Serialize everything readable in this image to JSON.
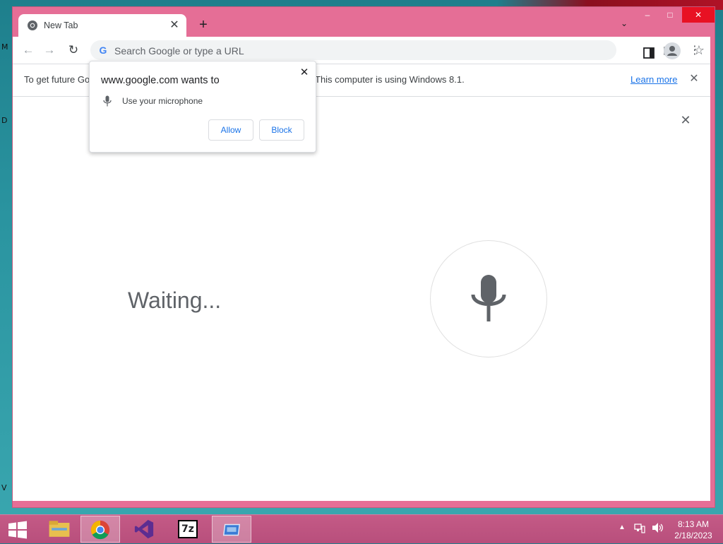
{
  "browser": {
    "tab": {
      "title": "New Tab",
      "favicon": "chrome-icon"
    },
    "window_controls": {
      "minimize": "–",
      "maximize": "□",
      "close": "✕"
    },
    "omnibox": {
      "placeholder": "Search Google or type a URL",
      "value": ""
    },
    "infobar": {
      "text_left": "To get future Go",
      "text_right": "This computer is using Windows 8.1.",
      "learn_more": "Learn more"
    },
    "permission_popup": {
      "title": "www.google.com wants to",
      "item": "Use your microphone",
      "allow": "Allow",
      "block": "Block"
    },
    "voice": {
      "status": "Waiting..."
    }
  },
  "taskbar": {
    "apps": [
      "file-explorer-icon",
      "chrome-icon",
      "visual-studio-icon",
      "7zip-icon",
      "remote-desktop-icon"
    ],
    "sevenzip_label": "7z",
    "clock": {
      "time": "8:13 AM",
      "date": "2/18/2023"
    }
  },
  "desktop": {
    "edge_letters": [
      "M",
      "D",
      "V"
    ]
  },
  "colors": {
    "window_frame": "#e56e96",
    "accent_blue": "#1a73e8",
    "close_red": "#e81123",
    "taskbar": "#c45a86"
  }
}
